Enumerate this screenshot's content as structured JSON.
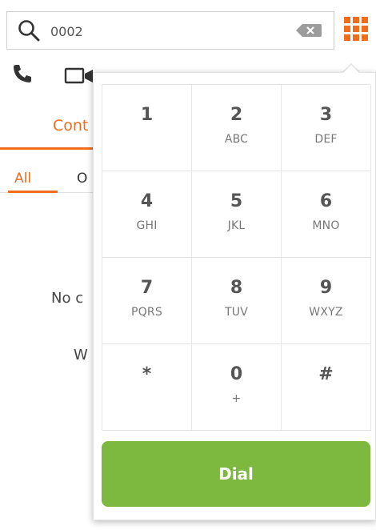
{
  "search": {
    "value": "0002",
    "icon": "search-icon",
    "clear_icon": "backspace-icon"
  },
  "dialpad_toggle_icon": "dialpad-grid-icon",
  "actions": [
    {
      "icon": "phone-icon"
    },
    {
      "icon": "video-camera-icon"
    }
  ],
  "background": {
    "main_tab": "Cont",
    "sub_tabs": [
      {
        "label": "All",
        "active": true
      },
      {
        "label": "O",
        "active": false
      }
    ],
    "empty_text": "No c",
    "empty_subtext": "W"
  },
  "dialpad": {
    "keys": [
      {
        "digit": "1",
        "letters": ""
      },
      {
        "digit": "2",
        "letters": "ABC"
      },
      {
        "digit": "3",
        "letters": "DEF"
      },
      {
        "digit": "4",
        "letters": "GHI"
      },
      {
        "digit": "5",
        "letters": "JKL"
      },
      {
        "digit": "6",
        "letters": "MNO"
      },
      {
        "digit": "7",
        "letters": "PQRS"
      },
      {
        "digit": "8",
        "letters": "TUV"
      },
      {
        "digit": "9",
        "letters": "WXYZ"
      },
      {
        "digit": "*",
        "letters": ""
      },
      {
        "digit": "0",
        "letters": "+"
      },
      {
        "digit": "#",
        "letters": ""
      }
    ],
    "dial_label": "Dial"
  },
  "colors": {
    "accent": "#ef6d1d",
    "dial_button": "#7db93f"
  }
}
